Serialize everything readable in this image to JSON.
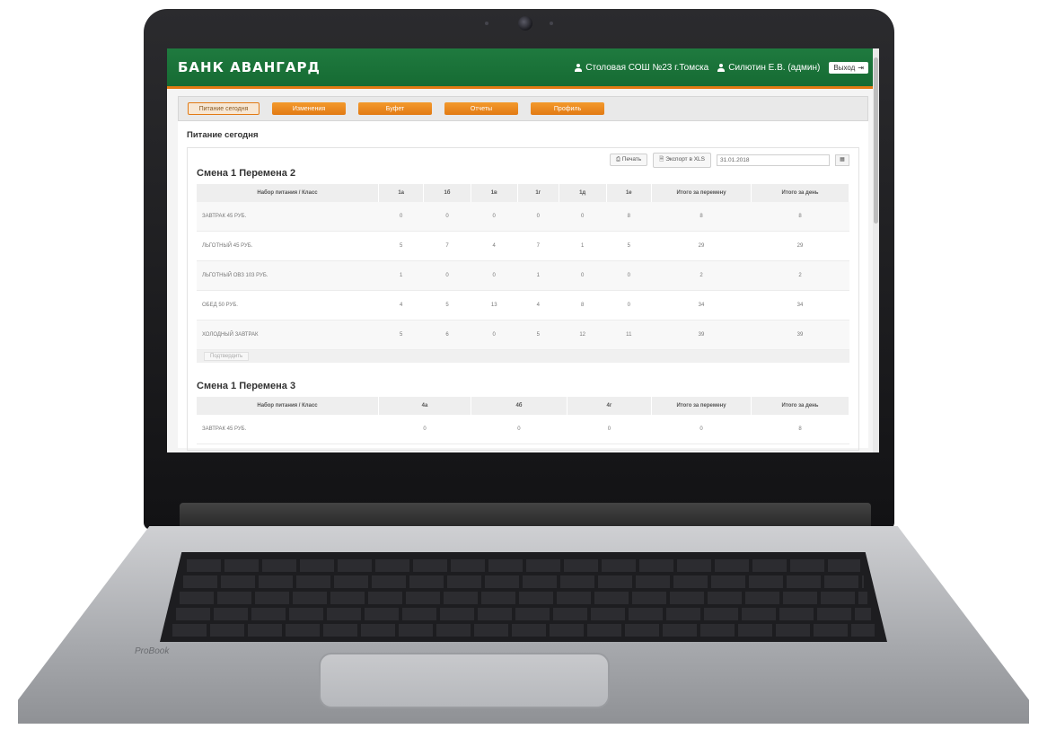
{
  "app": {
    "logo": "БАНК АВАНГАРД",
    "organization": "Столовая СОШ №23 г.Томска",
    "user": "Силютин Е.В. (админ)",
    "logout_label": "Выход"
  },
  "nav": {
    "tabs": [
      {
        "label": "Питание сегодня",
        "active": true
      },
      {
        "label": "Изменения",
        "active": false
      },
      {
        "label": "Буфет",
        "active": false
      },
      {
        "label": "Отчеты",
        "active": false
      },
      {
        "label": "Профиль",
        "active": false
      }
    ]
  },
  "page": {
    "title": "Питание сегодня",
    "print_label": "Печать",
    "export_label": "Экспорт в XLS",
    "date_value": "31.01.2018"
  },
  "section1": {
    "title": "Смена 1 Перемена 2",
    "headers": [
      "Набор питания / Класс",
      "1а",
      "1б",
      "1в",
      "1г",
      "1д",
      "1е",
      "Итого за перемену",
      "Итого за день"
    ],
    "rows": [
      {
        "name": "ЗАВТРАК 45 РУБ.",
        "values": [
          "0",
          "0",
          "0",
          "0",
          "0",
          "8",
          "8",
          "8"
        ]
      },
      {
        "name": "ЛЬГОТНЫЙ 45 РУБ.",
        "values": [
          "5",
          "7",
          "4",
          "7",
          "1",
          "5",
          "29",
          "29"
        ]
      },
      {
        "name": "ЛЬГОТНЫЙ ОВЗ 103 РУБ.",
        "values": [
          "1",
          "0",
          "0",
          "1",
          "0",
          "0",
          "2",
          "2"
        ]
      },
      {
        "name": "ОБЕД 50 РУБ.",
        "values": [
          "4",
          "5",
          "13",
          "4",
          "8",
          "0",
          "34",
          "34"
        ]
      },
      {
        "name": "ХОЛОДНЫЙ ЗАВТРАК",
        "values": [
          "5",
          "6",
          "0",
          "5",
          "12",
          "11",
          "39",
          "39"
        ]
      }
    ],
    "confirm_label": "Подтвердить"
  },
  "section2": {
    "title": "Смена 1 Перемена 3",
    "headers": [
      "Набор питания / Класс",
      "4а",
      "4б",
      "4г",
      "Итого за перемену",
      "Итого за день"
    ],
    "rows": [
      {
        "name": "ЗАВТРАК 45 РУБ.",
        "values": [
          "0",
          "0",
          "0",
          "0",
          "8"
        ]
      }
    ]
  },
  "laptop": {
    "brand": "ProBook"
  }
}
